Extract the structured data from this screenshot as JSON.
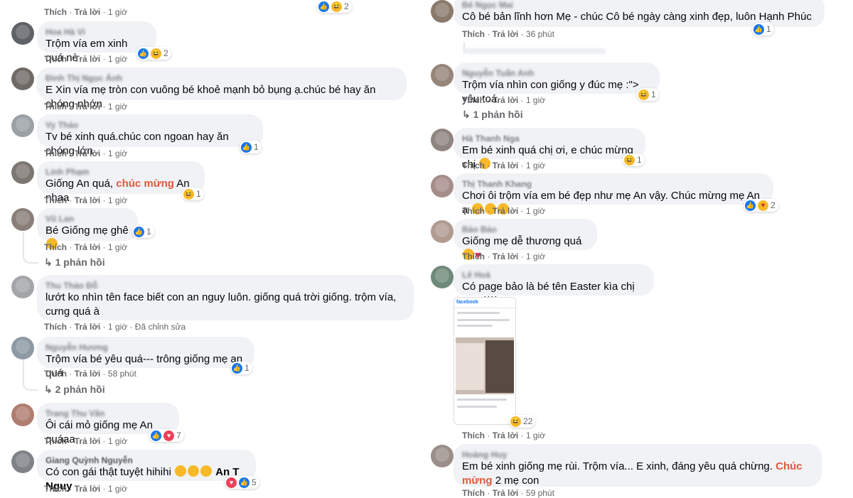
{
  "actions": {
    "like": "Thích",
    "reply": "Trả lời",
    "edited": "Đã chỉnh sửa"
  },
  "left": [
    {
      "name": "Hoa Hà Vi",
      "text": "Trộm vía em xinh quá nè",
      "time": "1 giờ",
      "reactions": [
        "like",
        "haha"
      ],
      "count": "2"
    },
    {
      "name": "Đinh Thị Ngọc Ánh",
      "text": "E Xin vía mẹ tròn con vuông bé khoẻ mạnh bỏ bụng ạ.chúc bé hay ăn chóng nhớn",
      "time": "1 giờ"
    },
    {
      "name": "Vy Thảo",
      "text": "Tv bé xinh quá.chúc con ngoan hay ăn chóng lớn",
      "time": "1 giờ",
      "reactions": [
        "like"
      ],
      "count": "1"
    },
    {
      "name": "Linh Phạm",
      "text_before": "Giống An quá, ",
      "text_highlight": "chúc mừng",
      "text_after": " An nhaa",
      "time": "1 giờ",
      "reactions": [
        "haha"
      ],
      "count": "1"
    },
    {
      "name": "Vũ Lan",
      "text": "Bé Giống mẹ ghê",
      "time": "1 giờ",
      "reactions": [
        "like"
      ],
      "count": "1",
      "replies": "1 phản hồi"
    },
    {
      "name": "Thu Thảo Đỗ",
      "text": "lướt ko nhìn tên face biết con an nguy luôn. giống quá trời giống. trộm vía, cưng quá à",
      "time": "1 giờ"
    },
    {
      "name": "Nguyễn Hương",
      "text": "Trộm vía bé yêu quá--- trông giống mẹ an quá",
      "time": "58 phút",
      "reactions": [
        "like"
      ],
      "count": "1",
      "replies": "2 phản hồi"
    },
    {
      "name": "Trang Thu Vân",
      "text": "Ôi cái mỏ giống mẹ An quáaa",
      "time": "1 giờ",
      "reactions": [
        "like",
        "love"
      ],
      "count": "7"
    },
    {
      "name": "Giang Quỳnh Nguyễn",
      "text": "Có con gái thật tuyệt hihihi",
      "tag": "An T Nguy",
      "time": "1 giờ",
      "reactions": [
        "love",
        "like"
      ],
      "count": "5"
    }
  ],
  "left_top_partial": {
    "time": "1 giờ",
    "count": "2"
  },
  "right": [
    {
      "name": "Bé Ngọc Mai",
      "text": "Cô bé bản lĩnh hơn Mẹ - chúc Cô bé ngày càng xinh đẹp, luôn Hạnh Phúc",
      "time": "36 phút",
      "reactions": [
        "like"
      ],
      "count": "1"
    },
    {
      "name": "Nguyễn Tuấn Anh",
      "text": "Trộm vía nhìn con giống y đúc mẹ :\"> yêu toá",
      "time": "1 giờ",
      "reactions": [
        "haha"
      ],
      "count": "1",
      "replies": "1 phản hồi"
    },
    {
      "name": "Hà Thanh Nga",
      "text": "Em bé xinh quá chị ơi, e chúc mừng chị",
      "time": "1 giờ",
      "reactions": [
        "haha"
      ],
      "count": "1"
    },
    {
      "name": "Thị Thanh Khang",
      "text": "Chơi ôi trộm vía em bé đẹp như mẹ An vậy. Chúc mừng mẹ An ạ",
      "time": "1 giờ",
      "reactions": [
        "like",
        "care"
      ],
      "count": "2"
    },
    {
      "name": "Bảo Bảo",
      "text": "Giống mẹ dễ thương quá",
      "time": "1 giờ"
    },
    {
      "name": "Lê Hoà",
      "text": "Có page bảo là bé tên Easter kìa chị An =))))",
      "time": "1 giờ",
      "reactions": [
        "haha"
      ],
      "count": "22",
      "screenshot_brand": "facebook"
    },
    {
      "name": "Hoàng Huy",
      "text_before": "Em bé xinh giống mẹ rùi. Trộm vía... E xinh, đáng yêu quá chừng. ",
      "text_highlight": "Chúc mừng",
      "text_after": " 2 mẹ con",
      "time": "59 phút"
    }
  ],
  "colors": {
    "bubble": "#f0f2f5",
    "highlight": "#e05a3b",
    "like": "#1877f2",
    "love": "#f33e58",
    "haha": "#f7b928",
    "meta": "#65676b"
  }
}
